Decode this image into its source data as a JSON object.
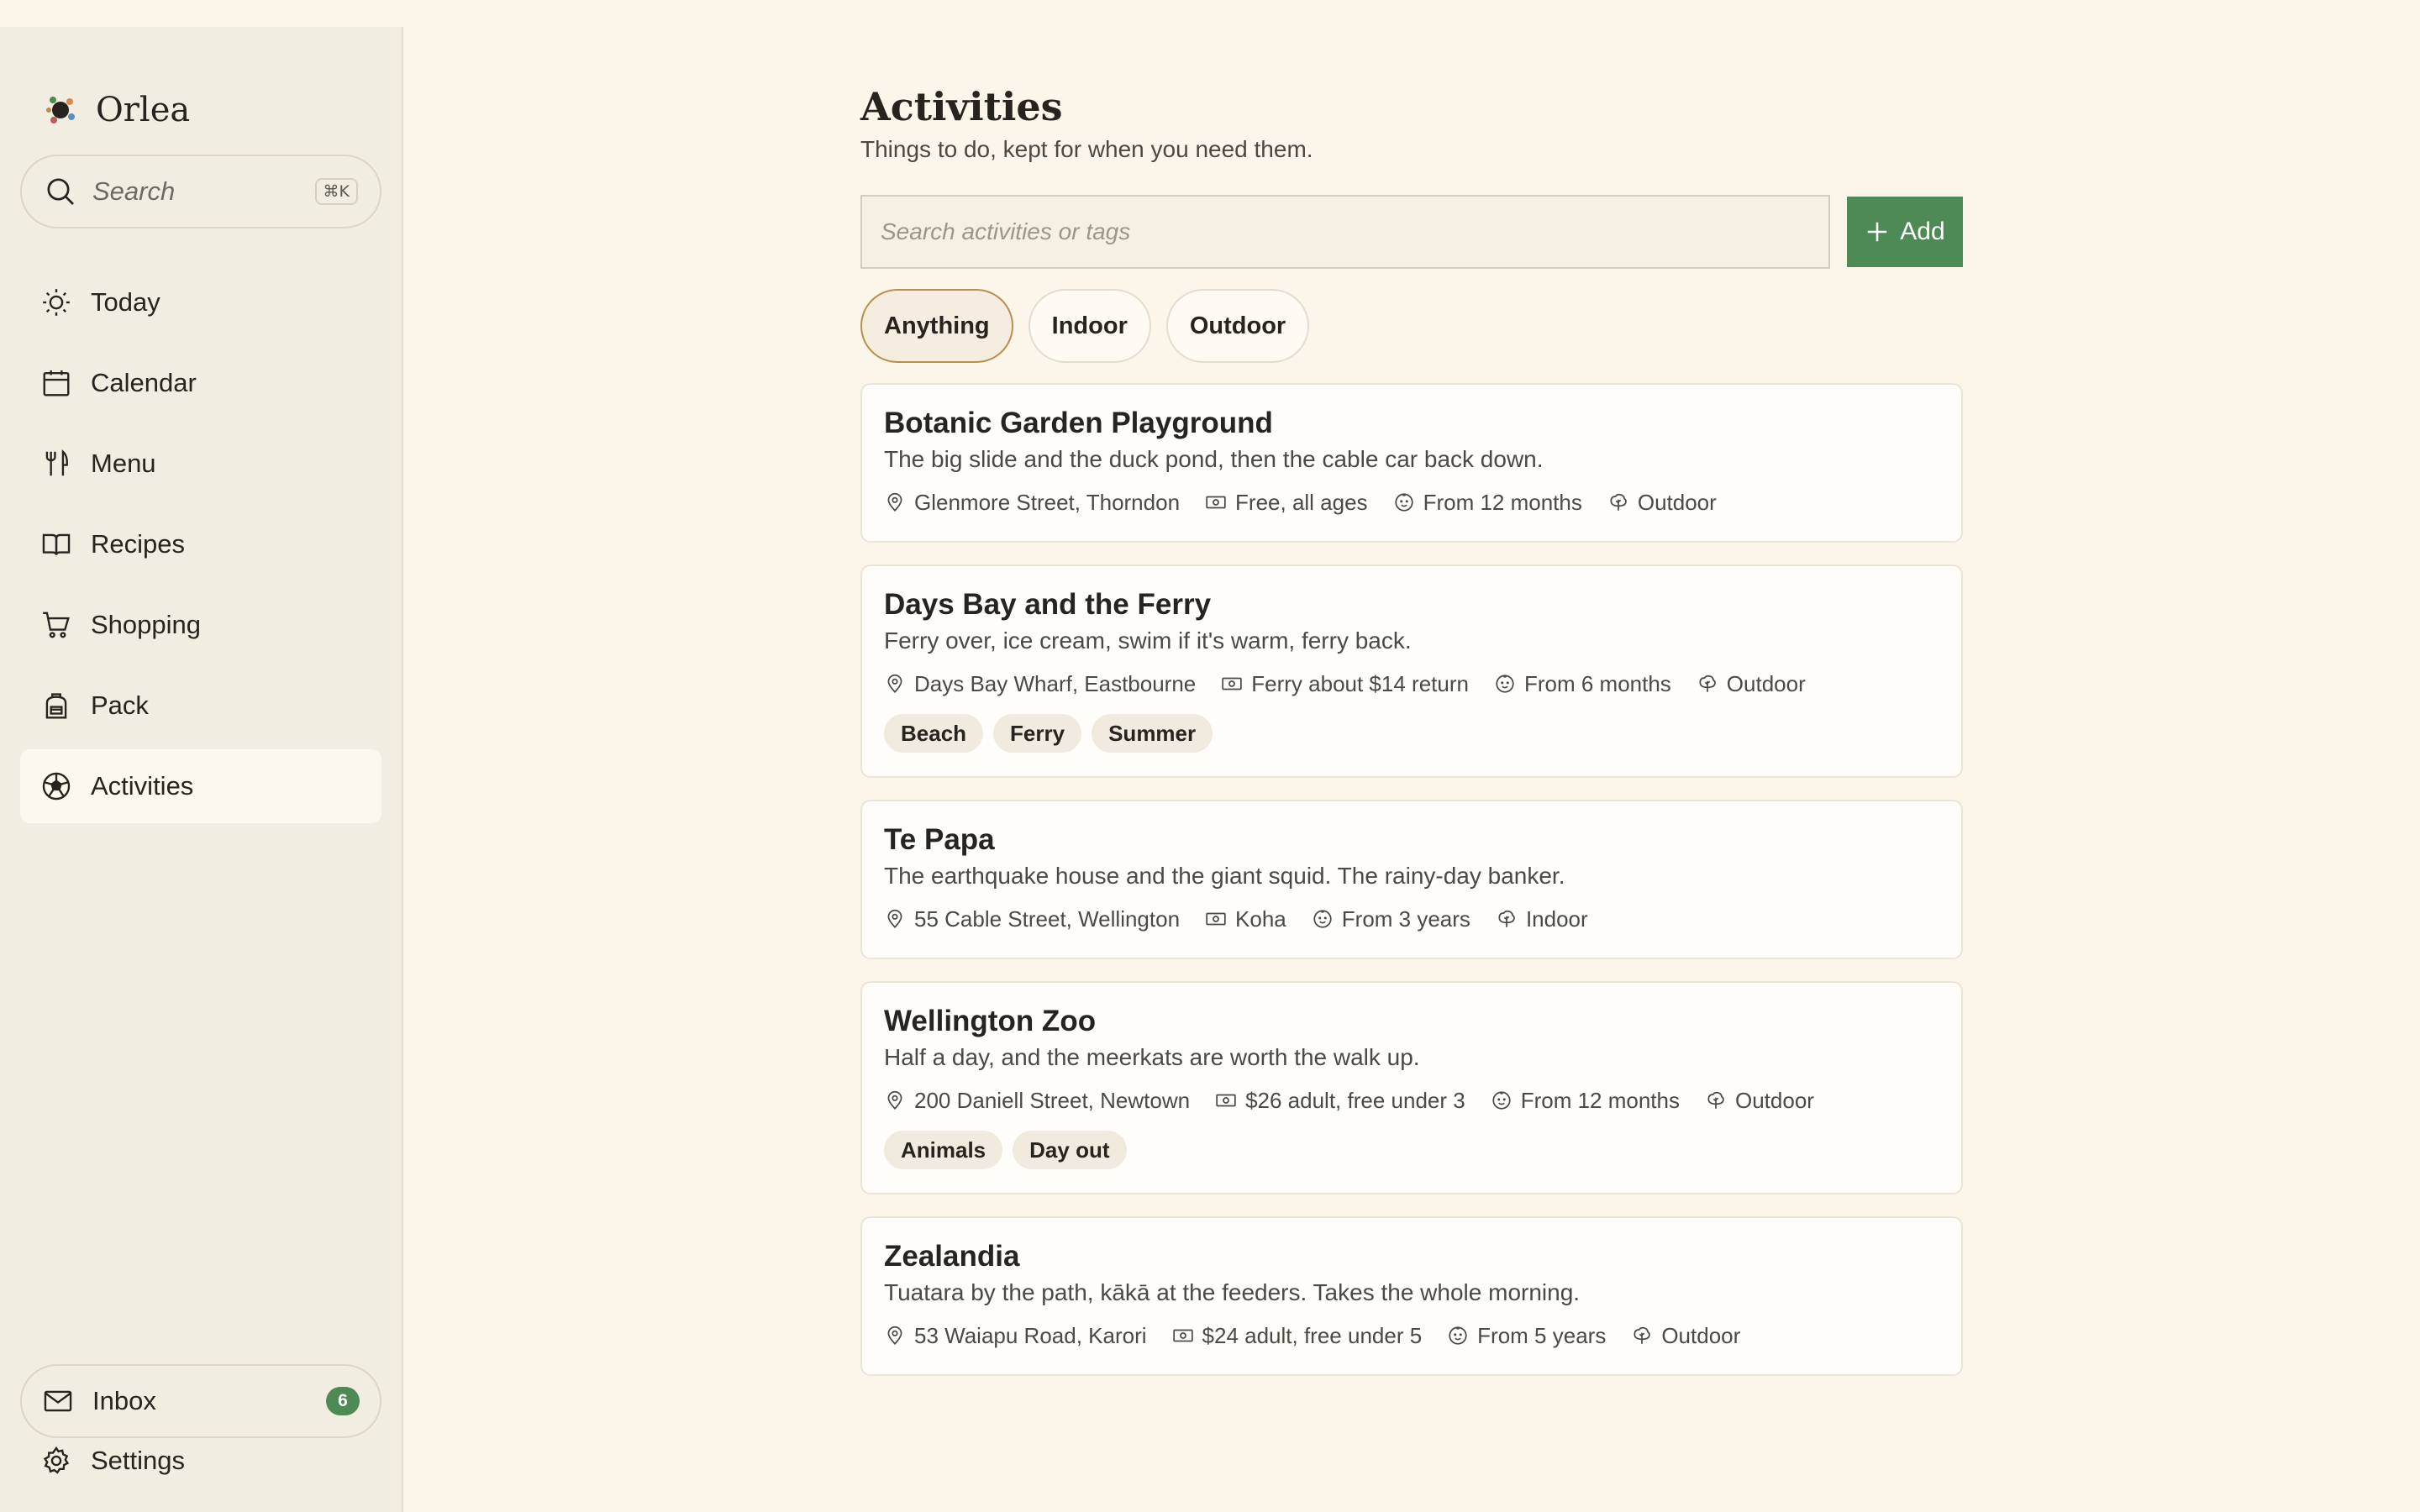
{
  "app": {
    "name": "Orlea"
  },
  "sidebar": {
    "search": {
      "label": "Search",
      "shortcut": "⌘K"
    },
    "items": [
      {
        "label": "Today",
        "icon": "sun-icon"
      },
      {
        "label": "Calendar",
        "icon": "calendar-icon"
      },
      {
        "label": "Menu",
        "icon": "utensils-icon"
      },
      {
        "label": "Recipes",
        "icon": "book-icon"
      },
      {
        "label": "Shopping",
        "icon": "cart-icon"
      },
      {
        "label": "Pack",
        "icon": "backpack-icon"
      },
      {
        "label": "Activities",
        "icon": "ball-icon",
        "active": true
      }
    ],
    "inbox": {
      "label": "Inbox",
      "count": "6"
    },
    "settings": {
      "label": "Settings"
    }
  },
  "page": {
    "title": "Activities",
    "subtitle": "Things to do, kept for when you need them.",
    "search_placeholder": "Search activities or tags",
    "add_label": "Add",
    "filters": [
      {
        "label": "Anything",
        "active": true
      },
      {
        "label": "Indoor",
        "active": false
      },
      {
        "label": "Outdoor",
        "active": false
      }
    ]
  },
  "activities": [
    {
      "title": "Botanic Garden Playground",
      "description": "The big slide and the duck pond, then the cable car back down.",
      "location": "Glenmore Street, Thorndon",
      "cost": "Free, all ages",
      "age": "From 12 months",
      "setting": "Outdoor",
      "tags": []
    },
    {
      "title": "Days Bay and the Ferry",
      "description": "Ferry over, ice cream, swim if it's warm, ferry back.",
      "location": "Days Bay Wharf, Eastbourne",
      "cost": "Ferry about $14 return",
      "age": "From 6 months",
      "setting": "Outdoor",
      "tags": [
        "Beach",
        "Ferry",
        "Summer"
      ]
    },
    {
      "title": "Te Papa",
      "description": "The earthquake house and the giant squid. The rainy-day banker.",
      "location": "55 Cable Street, Wellington",
      "cost": "Koha",
      "age": "From 3 years",
      "setting": "Indoor",
      "tags": []
    },
    {
      "title": "Wellington Zoo",
      "description": "Half a day, and the meerkats are worth the walk up.",
      "location": "200 Daniell Street, Newtown",
      "cost": "$26 adult, free under 3",
      "age": "From 12 months",
      "setting": "Outdoor",
      "tags": [
        "Animals",
        "Day out"
      ]
    },
    {
      "title": "Zealandia",
      "description": "Tuatara by the path, kākā at the feeders. Takes the whole morning.",
      "location": "53 Waiapu Road, Karori",
      "cost": "$24 adult, free under 5",
      "age": "From 5 years",
      "setting": "Outdoor",
      "tags": []
    }
  ],
  "colors": {
    "accent_green": "#4e8a56",
    "background": "#fcf5ea",
    "sidebar": "#f1ede1",
    "active_pill_border": "#b88f4e"
  }
}
